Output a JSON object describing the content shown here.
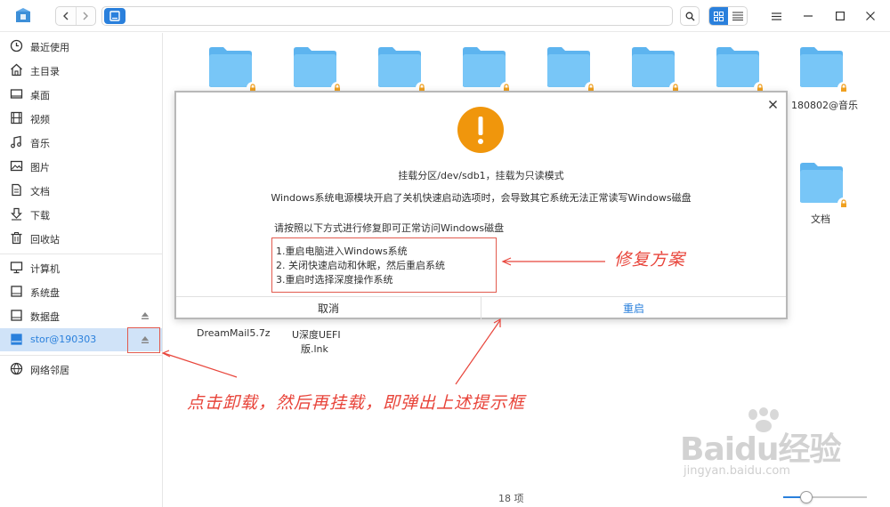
{
  "location": {
    "path": ""
  },
  "sidebar": {
    "items": [
      {
        "label": "最近使用",
        "icon": "clock-icon"
      },
      {
        "label": "主目录",
        "icon": "home-icon"
      },
      {
        "label": "桌面",
        "icon": "desktop-icon"
      },
      {
        "label": "视频",
        "icon": "video-icon"
      },
      {
        "label": "音乐",
        "icon": "music-icon"
      },
      {
        "label": "图片",
        "icon": "picture-icon"
      },
      {
        "label": "文档",
        "icon": "document-icon"
      },
      {
        "label": "下载",
        "icon": "download-icon"
      },
      {
        "label": "回收站",
        "icon": "trash-icon"
      },
      {
        "label": "计算机",
        "icon": "computer-icon"
      },
      {
        "label": "系统盘",
        "icon": "disk-icon"
      },
      {
        "label": "数据盘",
        "icon": "disk-icon"
      },
      {
        "label": "stor@190303",
        "icon": "disk-icon",
        "selected": true
      },
      {
        "label": "网络邻居",
        "icon": "network-icon"
      }
    ]
  },
  "content": {
    "folder_labels": [
      "180802@音乐",
      "文档"
    ],
    "file_labels": [
      "DreamMail5.7z",
      "U深度UEFI",
      "版.lnk"
    ]
  },
  "dialog": {
    "title": "挂载分区/dev/sdb1，挂载为只读模式",
    "message": "Windows系统电源模块开启了关机快速启动选项时，会导致其它系统无法正常读写Windows磁盘",
    "instruction": "请按照以下方式进行修复即可正常访问Windows磁盘",
    "steps": [
      "1.重启电脑进入Windows系统",
      "2. 关闭快速启动和休眠，然后重启系统",
      "3.重启时选择深度操作系统"
    ],
    "cancel_label": "取消",
    "ok_label": "重启"
  },
  "annotations": {
    "fix_label": "修复方案",
    "eject_note": "点击卸载，然后再挂载，即弹出上述提示框"
  },
  "status": {
    "count": "18 项"
  },
  "zoom": {
    "level": 0.28
  },
  "watermark": {
    "brand": "Baidu经验",
    "site": "jingyan.baidu.com"
  },
  "colors": {
    "accent": "#2a80dc",
    "folder": "#6ec0f5",
    "warning": "#f0960c",
    "annotation": "#e8443a"
  }
}
